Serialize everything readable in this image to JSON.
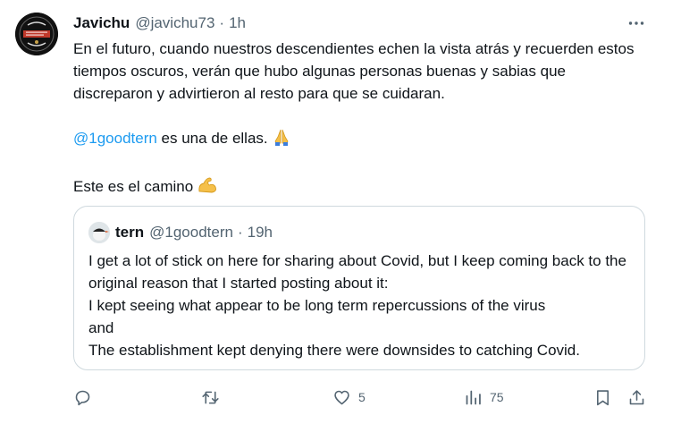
{
  "tweet": {
    "author": {
      "name": "Javichu",
      "handle": "@javichu73",
      "time": "1h"
    },
    "paragraphs": [
      "En el futuro, cuando nuestros descendientes echen la vista atrás y recuerden estos tiempos oscuros, verán que hubo algunas personas buenas y sabias que discreparon y advirtieron al resto para que se cuidaran."
    ],
    "mention": "@1goodtern",
    "mention_rest": " es una de ellas.",
    "closing": "Este es el camino",
    "avatar_lettering": [
      "RODRIGO",
      "EL RESPETO"
    ]
  },
  "quote": {
    "author": {
      "name": "tern",
      "handle": "@1goodtern",
      "time": "19h"
    },
    "lines": [
      "I get a lot of stick on here for sharing about Covid, but I keep coming back to the original reason that I started posting about it:",
      "I kept seeing what appear to be long term repercussions of the virus",
      "and",
      "The establishment kept denying there were downsides to catching Covid."
    ]
  },
  "actions": {
    "reply": "",
    "retweet": "",
    "like": "5",
    "views": "75"
  },
  "icons": {
    "more": "more-dots-icon",
    "reply": "reply-icon",
    "retweet": "retweet-icon",
    "like": "heart-icon",
    "views": "views-icon",
    "bookmark": "bookmark-icon",
    "share": "share-icon",
    "emoji_1": "folded-hands-emoji",
    "emoji_2": "flexed-biceps-emoji"
  },
  "colors": {
    "link": "#1d9bf0",
    "muted": "#536471",
    "border": "#cfd9de"
  }
}
